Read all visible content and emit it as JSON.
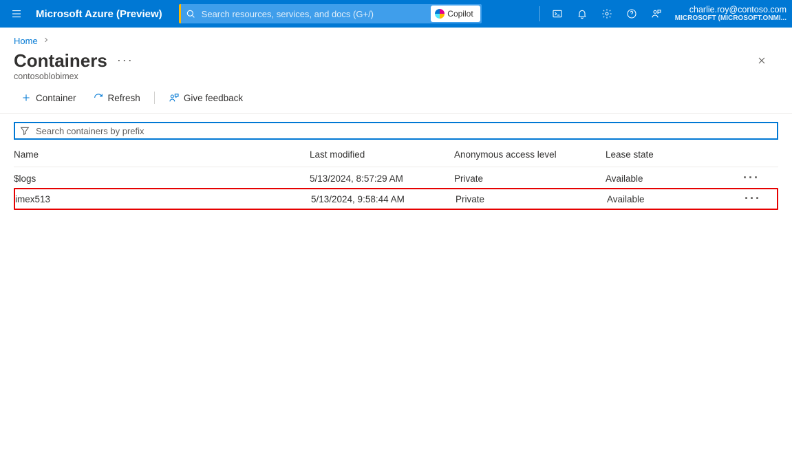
{
  "topbar": {
    "brand": "Microsoft Azure (Preview)",
    "search_placeholder": "Search resources, services, and docs (G+/)",
    "copilot_label": "Copilot",
    "account_email": "charlie.roy@contoso.com",
    "account_tenant": "MICROSOFT (MICROSOFT.ONMI..."
  },
  "breadcrumb": {
    "home": "Home"
  },
  "page": {
    "title": "Containers",
    "subtitle": "contosoblobimex"
  },
  "toolbar": {
    "add_container": "Container",
    "refresh": "Refresh",
    "feedback": "Give feedback"
  },
  "filter": {
    "placeholder": "Search containers by prefix"
  },
  "table": {
    "headers": {
      "name": "Name",
      "last_modified": "Last modified",
      "access": "Anonymous access level",
      "lease": "Lease state"
    },
    "rows": [
      {
        "name": "$logs",
        "last_modified": "5/13/2024, 8:57:29 AM",
        "access": "Private",
        "lease": "Available",
        "highlight": false
      },
      {
        "name": "imex513",
        "last_modified": "5/13/2024, 9:58:44 AM",
        "access": "Private",
        "lease": "Available",
        "highlight": true
      }
    ]
  }
}
